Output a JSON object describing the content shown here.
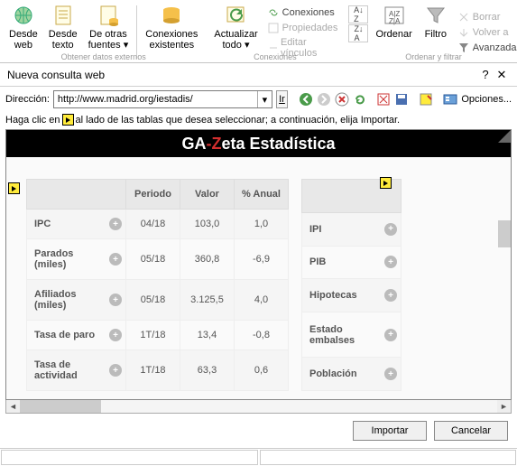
{
  "ribbon": {
    "desde_web": "Desde\nweb",
    "desde_texto": "Desde\ntexto",
    "de_otras": "De otras\nfuentes ▾",
    "conexiones_ex": "Conexiones\nexistentes",
    "actualizar": "Actualizar\ntodo ▾",
    "grupo1": "Obtener datos externos",
    "grupo2": "Conexiones",
    "grupo3": "Ordenar y filtrar",
    "conexiones": "Conexiones",
    "propiedades": "Propiedades",
    "editar_vinculos": "Editar vínculos",
    "az": "A↓Z",
    "za": "Z↓A",
    "ordenar": "Ordenar",
    "filtro": "Filtro",
    "borrar": "Borrar",
    "volver": "Volver a",
    "avanzada": "Avanzada"
  },
  "dialog": {
    "title": "Nueva consulta web",
    "help": "?",
    "close": "✕",
    "dir_label": "Dirección:",
    "url": "http://www.madrid.org/iestadis/",
    "ir": "Ir",
    "opciones": "Opciones...",
    "hint_pre": "Haga clic en",
    "hint_post": "al lado de las tablas que desea seleccionar; a continuación, elija Importar.",
    "importar": "Importar",
    "cancelar": "Cancelar"
  },
  "page": {
    "banner_ga": "GA",
    "banner_z": "-Z",
    "banner_rest": "eta Estadística",
    "headers": {
      "c0": "",
      "c1": "Periodo",
      "c2": "Valor",
      "c3": "% Anual"
    },
    "rows": [
      {
        "label": "IPC",
        "periodo": "04/18",
        "valor": "103,0",
        "anual": "1,0"
      },
      {
        "label": "Parados (miles)",
        "periodo": "05/18",
        "valor": "360,8",
        "anual": "-6,9"
      },
      {
        "label": "Afiliados (miles)",
        "periodo": "05/18",
        "valor": "3.125,5",
        "anual": "4,0"
      },
      {
        "label": "Tasa de paro",
        "periodo": "1T/18",
        "valor": "13,4",
        "anual": "-0,8"
      },
      {
        "label": "Tasa de actividad",
        "periodo": "1T/18",
        "valor": "63,3",
        "anual": "0,6"
      }
    ],
    "rows2": [
      {
        "label": "IPI"
      },
      {
        "label": "PIB"
      },
      {
        "label": "Hipotecas"
      },
      {
        "label": "Estado embalses"
      },
      {
        "label": "Población"
      }
    ]
  }
}
